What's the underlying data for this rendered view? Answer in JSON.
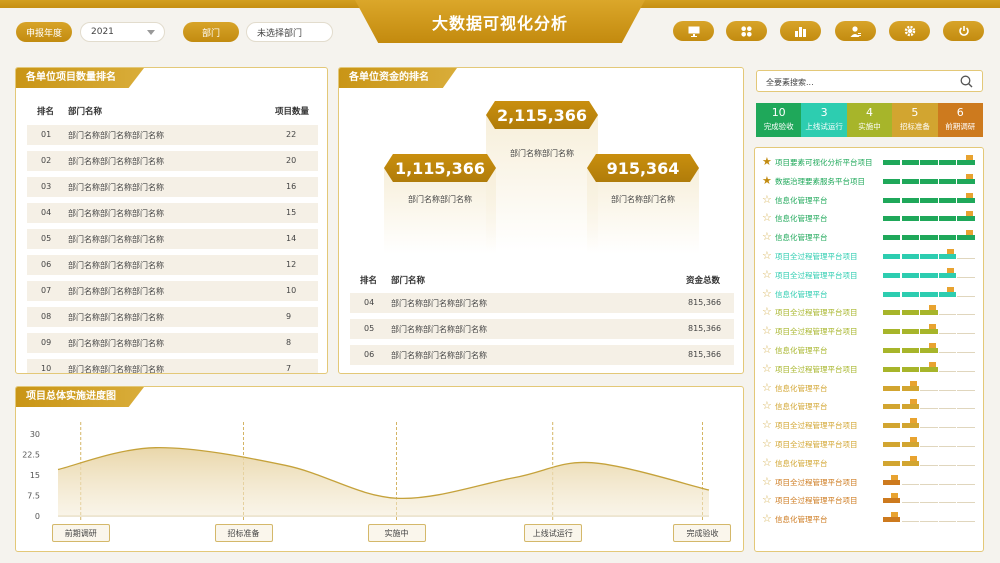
{
  "header": {
    "title": "大数据可视化分析",
    "year_label": "申报年度",
    "year_value": "2021",
    "dept_label": "部门",
    "dept_value": "未选择部门",
    "tools": [
      "monitor-icon",
      "apps-icon",
      "bar-chart-icon",
      "user-icon",
      "gear-icon",
      "power-icon"
    ]
  },
  "count_ranking": {
    "title": "各单位项目数量排名",
    "headers": [
      "排名",
      "部门名称",
      "项目数量"
    ],
    "rows": [
      {
        "rank": "01",
        "name": "部门名称部门名称部门名称",
        "count": "22"
      },
      {
        "rank": "02",
        "name": "部门名称部门名称部门名称",
        "count": "20"
      },
      {
        "rank": "03",
        "name": "部门名称部门名称部门名称",
        "count": "16"
      },
      {
        "rank": "04",
        "name": "部门名称部门名称部门名称",
        "count": "15"
      },
      {
        "rank": "05",
        "name": "部门名称部门名称部门名称",
        "count": "14"
      },
      {
        "rank": "06",
        "name": "部门名称部门名称部门名称",
        "count": "12"
      },
      {
        "rank": "07",
        "name": "部门名称部门名称部门名称",
        "count": "10"
      },
      {
        "rank": "08",
        "name": "部门名称部门名称部门名称",
        "count": "9"
      },
      {
        "rank": "09",
        "name": "部门名称部门名称部门名称",
        "count": "8"
      },
      {
        "rank": "10",
        "name": "部门名称部门名称部门名称",
        "count": "7"
      }
    ]
  },
  "fund_ranking": {
    "title": "各单位资金的排名",
    "podium": [
      {
        "value": "2,115,366",
        "name": "部门名称部门名称"
      },
      {
        "value": "1,115,366",
        "name": "部门名称部门名称"
      },
      {
        "value": "915,364",
        "name": "部门名称部门名称"
      }
    ],
    "headers": [
      "排名",
      "部门名称",
      "资金总数"
    ],
    "rows": [
      {
        "rank": "04",
        "name": "部门名称部门名称部门名称",
        "amount": "815,366"
      },
      {
        "rank": "05",
        "name": "部门名称部门名称部门名称",
        "amount": "815,366"
      },
      {
        "rank": "06",
        "name": "部门名称部门名称部门名称",
        "amount": "815,366"
      }
    ]
  },
  "progress_chart": {
    "title": "项目总体实施进度图"
  },
  "chart_data": {
    "type": "area",
    "title": "项目总体实施进度图",
    "categories": [
      "前期调研",
      "招标准备",
      "实施中",
      "上线试运行",
      "完成验收"
    ],
    "y_ticks": [
      "30",
      "22.5",
      "15",
      "7.5",
      "0"
    ],
    "ylim": [
      0,
      30
    ],
    "curve": [
      {
        "x": 0.0,
        "y": 17
      },
      {
        "x": 0.15,
        "y": 25
      },
      {
        "x": 0.35,
        "y": 18.5
      },
      {
        "x": 0.52,
        "y": 6.5
      },
      {
        "x": 0.7,
        "y": 14
      },
      {
        "x": 0.82,
        "y": 19.5
      },
      {
        "x": 1.0,
        "y": 9.5
      }
    ],
    "grid": false,
    "legend": "none",
    "color": "#c5a23b"
  },
  "search": {
    "placeholder": "全要素搜索..."
  },
  "stats": [
    {
      "value": "10",
      "label": "完成验收",
      "color": "#1fa85a"
    },
    {
      "value": "3",
      "label": "上线试运行",
      "color": "#2dcdb0"
    },
    {
      "value": "4",
      "label": "实施中",
      "color": "#a7b52a"
    },
    {
      "value": "5",
      "label": "招标准备",
      "color": "#d2a530"
    },
    {
      "value": "6",
      "label": "前期调研",
      "color": "#cd7a1e"
    }
  ],
  "projects": [
    {
      "name": "项目要素可视化分析平台项目",
      "starred": true,
      "color": "#1fa85a",
      "done": 5
    },
    {
      "name": "数据治理要素服务平台项目",
      "starred": true,
      "color": "#1fa85a",
      "done": 5
    },
    {
      "name": "信息化管理平台",
      "starred": false,
      "color": "#1fa85a",
      "done": 5
    },
    {
      "name": "信息化管理平台",
      "starred": false,
      "color": "#1fa85a",
      "done": 5
    },
    {
      "name": "信息化管理平台",
      "starred": false,
      "color": "#1fa85a",
      "done": 5
    },
    {
      "name": "项目全过程管理平台项目",
      "starred": false,
      "color": "#2dcdb0",
      "done": 4
    },
    {
      "name": "项目全过程管理平台项目",
      "starred": false,
      "color": "#2dcdb0",
      "done": 4
    },
    {
      "name": "信息化管理平台",
      "starred": false,
      "color": "#2dcdb0",
      "done": 4
    },
    {
      "name": "项目全过程管理平台项目",
      "starred": false,
      "color": "#a7b52a",
      "done": 3
    },
    {
      "name": "项目全过程管理平台项目",
      "starred": false,
      "color": "#a7b52a",
      "done": 3
    },
    {
      "name": "信息化管理平台",
      "starred": false,
      "color": "#a7b52a",
      "done": 3
    },
    {
      "name": "项目全过程管理平台项目",
      "starred": false,
      "color": "#a7b52a",
      "done": 3
    },
    {
      "name": "信息化管理平台",
      "starred": false,
      "color": "#d2a530",
      "done": 2
    },
    {
      "name": "信息化管理平台",
      "starred": false,
      "color": "#d2a530",
      "done": 2
    },
    {
      "name": "项目全过程管理平台项目",
      "starred": false,
      "color": "#d2a530",
      "done": 2
    },
    {
      "name": "项目全过程管理平台项目",
      "starred": false,
      "color": "#d2a530",
      "done": 2
    },
    {
      "name": "信息化管理平台",
      "starred": false,
      "color": "#d2a530",
      "done": 2
    },
    {
      "name": "项目全过程管理平台项目",
      "starred": false,
      "color": "#cd7a1e",
      "done": 1
    },
    {
      "name": "项目全过程管理平台项目",
      "starred": false,
      "color": "#cd7a1e",
      "done": 1
    },
    {
      "name": "信息化管理平台",
      "starred": false,
      "color": "#cd7a1e",
      "done": 1
    }
  ]
}
